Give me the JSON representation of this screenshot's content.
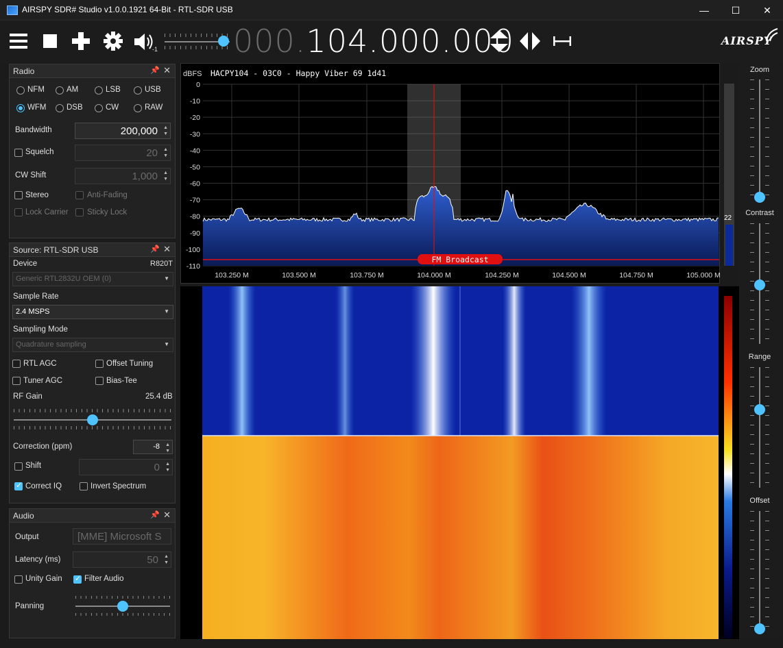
{
  "window": {
    "title": "AIRSPY SDR# Studio v1.0.0.1921 64-Bit - RTL-SDR USB",
    "minimize": "—",
    "maximize": "☐",
    "close": "✕"
  },
  "toolbar": {
    "menu_icon": "menu-icon",
    "stop_icon": "stop-icon",
    "add_icon": "plus-icon",
    "settings_icon": "gear-icon",
    "volume_icon": "speaker-icon",
    "volume_badge": "-1",
    "volume_level": 0.9,
    "frequency_dim": "000.",
    "frequency": "104.000.000",
    "logo": "AIRSPY"
  },
  "radio": {
    "title": "Radio",
    "modes_row1": [
      "NFM",
      "AM",
      "LSB",
      "USB"
    ],
    "modes_row2": [
      "WFM",
      "DSB",
      "CW",
      "RAW"
    ],
    "selected_mode": "WFM",
    "bandwidth_label": "Bandwidth",
    "bandwidth_value": "200,000",
    "squelch_label": "Squelch",
    "squelch_value": "20",
    "cw_shift_label": "CW Shift",
    "cw_shift_value": "1,000",
    "stereo_label": "Stereo",
    "anti_fading_label": "Anti-Fading",
    "lock_carrier_label": "Lock Carrier",
    "sticky_lock_label": "Sticky Lock"
  },
  "source": {
    "title": "Source: RTL-SDR USB",
    "device_label": "Device",
    "device_tuner": "R820T",
    "device_value": "Generic RTL2832U OEM (0)",
    "sample_rate_label": "Sample Rate",
    "sample_rate_value": "2.4 MSPS",
    "sampling_mode_label": "Sampling Mode",
    "sampling_mode_value": "Quadrature sampling",
    "rtl_agc_label": "RTL AGC",
    "offset_tuning_label": "Offset Tuning",
    "tuner_agc_label": "Tuner AGC",
    "bias_tee_label": "Bias-Tee",
    "rf_gain_label": "RF Gain",
    "rf_gain_value": "25.4 dB",
    "rf_gain_level": 0.5,
    "correction_label": "Correction (ppm)",
    "correction_value": "-8",
    "shift_label": "Shift",
    "shift_value": "0",
    "correct_iq_label": "Correct IQ",
    "invert_spectrum_label": "Invert Spectrum"
  },
  "audio": {
    "title": "Audio",
    "output_label": "Output",
    "output_value": "[MME] Microsoft S",
    "latency_label": "Latency (ms)",
    "latency_value": "50",
    "unity_gain_label": "Unity Gain",
    "filter_audio_label": "Filter Audio",
    "panning_label": "Panning",
    "panning_level": 0.5
  },
  "spectrum": {
    "unit_label": "dBFS",
    "station_info": "HACPY104 - 03C0 - Happy Viber 69  1d41",
    "band_label": "FM Broadcast",
    "level_value": "22",
    "y_ticks": [
      "0",
      "-10",
      "-20",
      "-30",
      "-40",
      "-50",
      "-60",
      "-70",
      "-80",
      "-90",
      "-100",
      "-110"
    ],
    "x_ticks": [
      "103.250 M",
      "103.500 M",
      "103.750 M",
      "104.000 M",
      "104.250 M",
      "104.500 M",
      "104.750 M",
      "105.000 M"
    ]
  },
  "side_controls": {
    "zoom_label": "Zoom",
    "contrast_label": "Contrast",
    "range_label": "Range",
    "offset_label": "Offset"
  },
  "colors": {
    "accent": "#4fc3ff",
    "spectrum_fill": "#1a3a8a",
    "band_marker": "#e01010"
  }
}
